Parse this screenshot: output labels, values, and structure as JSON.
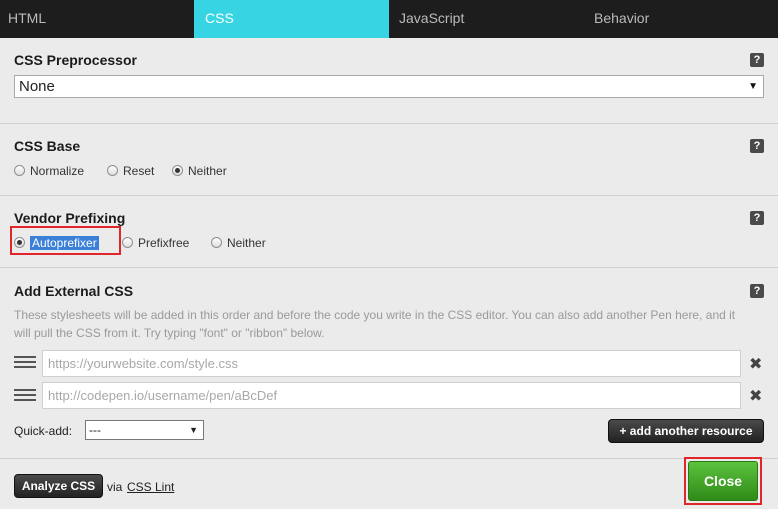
{
  "tabs": [
    {
      "label": "HTML",
      "active": false
    },
    {
      "label": "CSS",
      "active": true
    },
    {
      "label": "JavaScript",
      "active": false
    },
    {
      "label": "Behavior",
      "active": false
    }
  ],
  "preprocessor": {
    "title": "CSS Preprocessor",
    "value": "None",
    "help": "?"
  },
  "base": {
    "title": "CSS Base",
    "help": "?",
    "options": [
      {
        "label": "Normalize",
        "checked": false
      },
      {
        "label": "Reset",
        "checked": false
      },
      {
        "label": "Neither",
        "checked": true
      }
    ]
  },
  "prefix": {
    "title": "Vendor Prefixing",
    "help": "?",
    "options": [
      {
        "label": "Autoprefixer",
        "checked": true
      },
      {
        "label": "Prefixfree",
        "checked": false
      },
      {
        "label": "Neither",
        "checked": false
      }
    ]
  },
  "external": {
    "title": "Add External CSS",
    "help": "?",
    "description": "These stylesheets will be added in this order and before the code you write in the CSS editor. You can also add another Pen here, and it will pull the CSS from it. Try typing \"font\" or \"ribbon\" below.",
    "resources": [
      {
        "placeholder": "https://yourwebsite.com/style.css",
        "value": ""
      },
      {
        "placeholder": "http://codepen.io/username/pen/aBcDef",
        "value": ""
      }
    ],
    "remove_symbol": "✖",
    "quick_add_label": "Quick-add:",
    "quick_add_value": "---",
    "add_button": "+ add another resource"
  },
  "footer": {
    "analyze_button": "Analyze CSS",
    "via": "via",
    "lint_link": "CSS Lint",
    "close_button": "Close"
  },
  "colors": {
    "active_tab": "#37d5e4",
    "close_green": "#3ea427",
    "highlight_red": "#e0262a",
    "selection_blue": "#3a7fd8"
  }
}
